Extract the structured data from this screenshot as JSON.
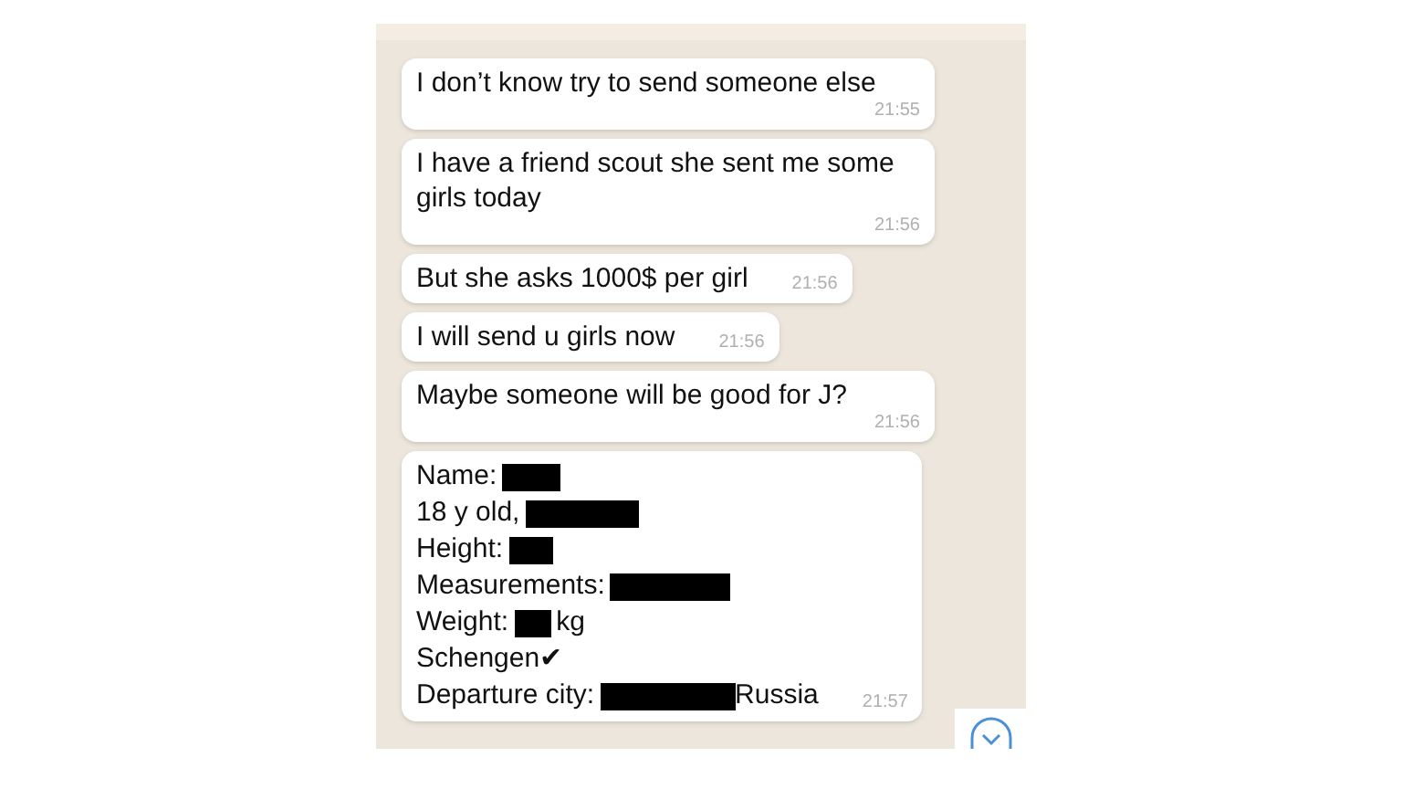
{
  "messages": [
    {
      "text": "I don’t know try to send someone else",
      "time": "21:55"
    },
    {
      "text": "I have a friend scout she sent me some girls today",
      "time": "21:56"
    },
    {
      "text": "But she asks 1000$  per girl",
      "time": "21:56"
    },
    {
      "text": "I will send u girls now",
      "time": "21:56"
    },
    {
      "text": "Maybe someone will be good for J?",
      "time": "21:56"
    },
    {
      "lines": [
        [
          {
            "kind": "text",
            "text": "Name:"
          },
          {
            "kind": "redaction"
          }
        ],
        [
          {
            "kind": "text",
            "text": "18 y old,"
          },
          {
            "kind": "redaction"
          }
        ],
        [
          {
            "kind": "text",
            "text": "Height:"
          },
          {
            "kind": "redaction"
          }
        ],
        [
          {
            "kind": "text",
            "text": "Measurements:"
          },
          {
            "kind": "redaction"
          }
        ],
        [
          {
            "kind": "text",
            "text": "Weight:"
          },
          {
            "kind": "redaction"
          },
          {
            "kind": "text",
            "text": "kg"
          }
        ],
        [
          {
            "kind": "text",
            "text": "Schengen✔"
          }
        ],
        [
          {
            "kind": "text",
            "text": "Departure city:"
          },
          {
            "kind": "redaction"
          },
          {
            "kind": "text",
            "text": "Russia"
          }
        ]
      ],
      "time": "21:57"
    }
  ]
}
